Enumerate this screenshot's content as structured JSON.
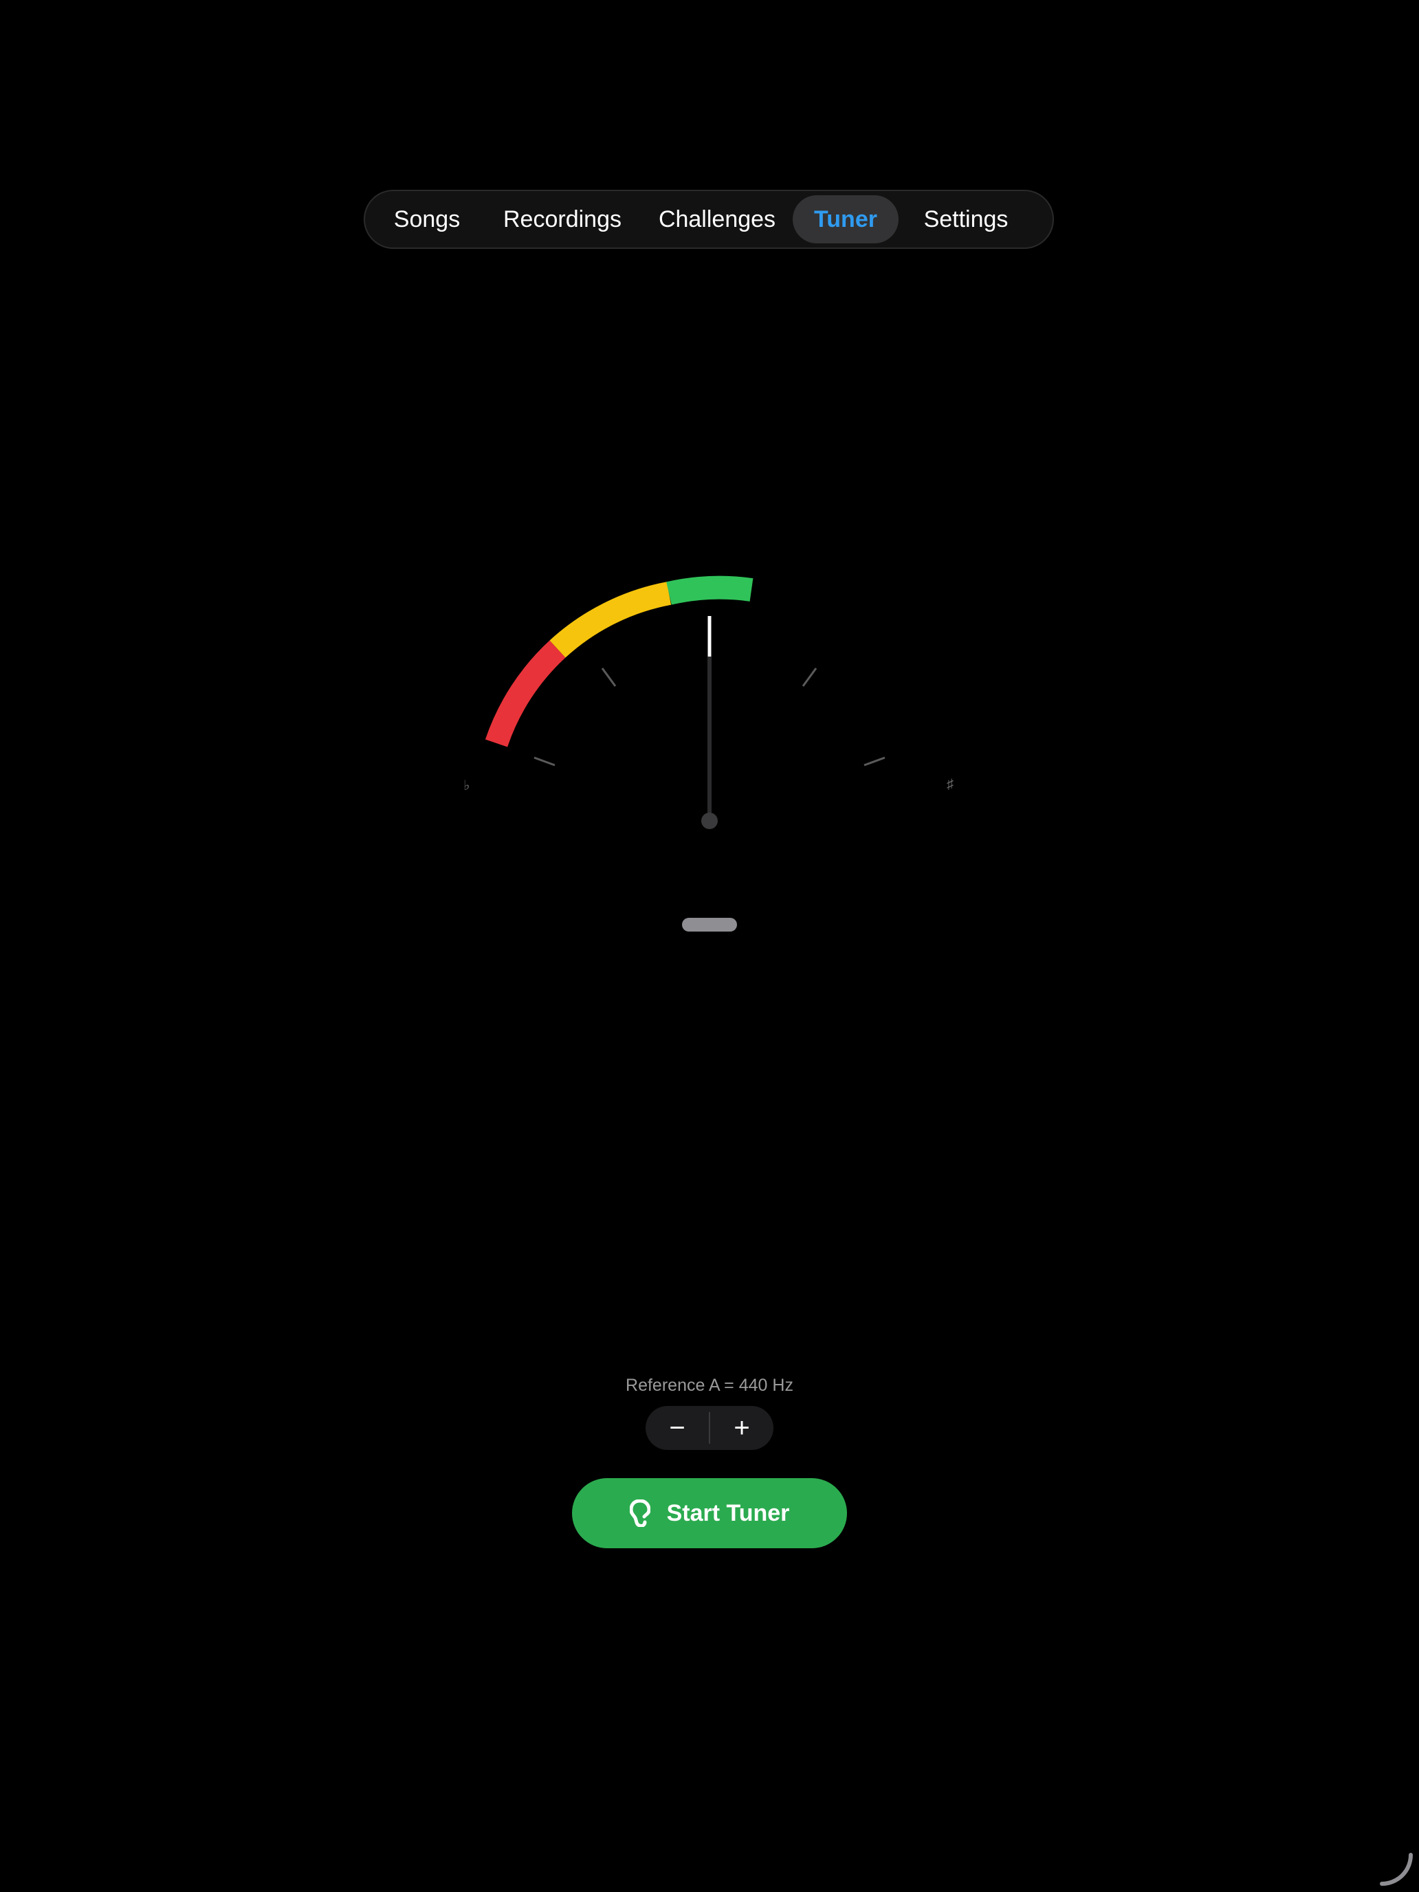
{
  "tabs": [
    {
      "label": "Songs",
      "selected": false
    },
    {
      "label": "Recordings",
      "selected": false
    },
    {
      "label": "Challenges",
      "selected": false
    },
    {
      "label": "Tuner",
      "selected": true
    },
    {
      "label": "Settings",
      "selected": false
    }
  ],
  "gauge": {
    "flat_symbol": "♭",
    "sharp_symbol": "♯",
    "needle_cents": 0,
    "zones": [
      {
        "name": "red",
        "color": "#e8333a"
      },
      {
        "name": "yellow",
        "color": "#f6c40c"
      },
      {
        "name": "green",
        "color": "#30c35a"
      }
    ],
    "needle_color": "#ffffff",
    "tick_color": "#5a5a5a"
  },
  "reference": {
    "text": "Reference A = 440 Hz",
    "decrement_label": "−",
    "increment_label": "+"
  },
  "start_button": {
    "label": "Start Tuner",
    "icon": "ear-icon",
    "color": "#2bab4f"
  },
  "colors": {
    "accent": "#2f9bf0",
    "background": "#000000"
  }
}
